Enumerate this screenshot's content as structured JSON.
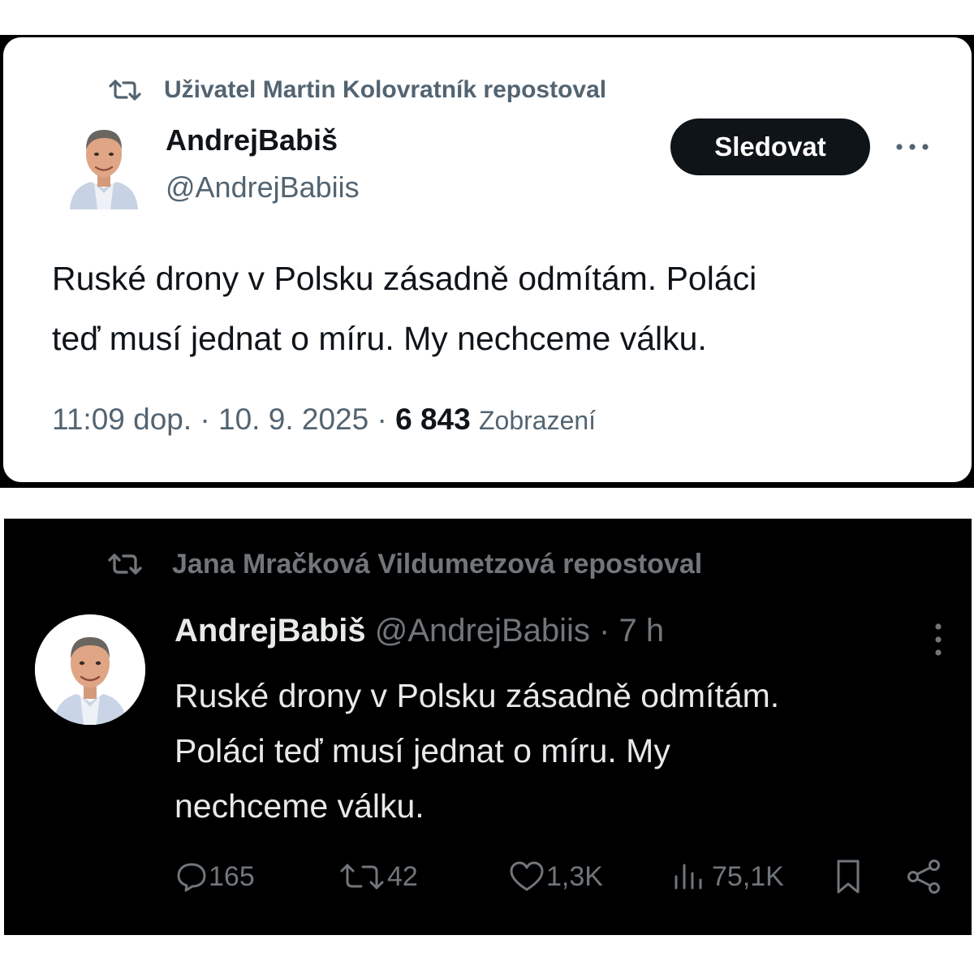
{
  "tweet_light": {
    "repost_label": "Uživatel Martin Kolovratník repostoval",
    "author_name": "AndrejBabiš",
    "author_handle": "@AndrejBabiis",
    "follow_label": "Sledovat",
    "body_line1": "Ruské drony v Polsku zásadně odmítám. Poláci",
    "body_line2": "teď musí jednat o míru. My nechceme válku.",
    "time": "11:09 dop.",
    "date": "10. 9. 2025",
    "separator": "·",
    "views_count": "6 843",
    "views_label": "Zobrazení",
    "icons": [
      "repost-icon",
      "avatar",
      "more-horizontal-icon"
    ],
    "colors": {
      "text": "#0f1419",
      "muted": "#536471",
      "button": "#0f1419"
    }
  },
  "tweet_dark": {
    "repost_label": "Jana Mračková Vildumetzová repostoval",
    "author_name": "AndrejBabiš",
    "author_handle": "@AndrejBabiis",
    "separator": "·",
    "time_ago": "7 h",
    "body_line1": "Ruské drony v Polsku zásadně odmítám.",
    "body_line2": "Poláci teď musí jednat o míru. My",
    "body_line3": "nechceme válku.",
    "actions": {
      "replies": "165",
      "reposts": "42",
      "likes": "1,3K",
      "views": "75,1K"
    },
    "icons": [
      "repost-icon",
      "more-vertical-icon",
      "reply-icon",
      "like-icon",
      "views-icon",
      "bookmark-icon",
      "share-icon"
    ],
    "colors": {
      "background": "#000000",
      "text": "#e7e9ea",
      "muted": "#71767b"
    }
  }
}
